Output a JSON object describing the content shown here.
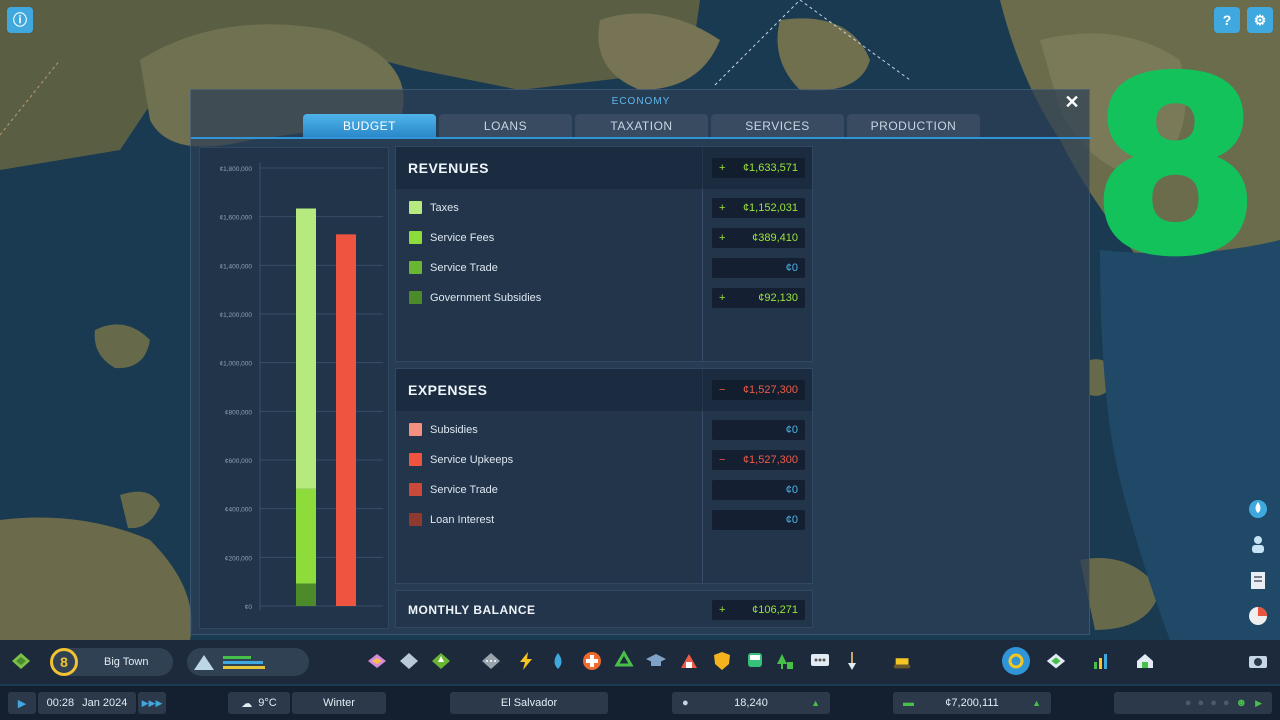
{
  "panel": {
    "title": "ECONOMY",
    "close_glyph": "✕",
    "tabs": [
      {
        "label": "BUDGET",
        "active": true
      },
      {
        "label": "LOANS",
        "active": false
      },
      {
        "label": "TAXATION",
        "active": false
      },
      {
        "label": "SERVICES",
        "active": false
      },
      {
        "label": "PRODUCTION",
        "active": false
      }
    ]
  },
  "overlay_number": "8",
  "revenues": {
    "title": "REVENUES",
    "total": {
      "sign": "+",
      "amount": "¢1,633,571"
    },
    "rows": [
      {
        "label": "Taxes",
        "sign": "+",
        "amount": "¢1,152,031",
        "color": "#b6ea7e"
      },
      {
        "label": "Service Fees",
        "sign": "+",
        "amount": "¢389,410",
        "color": "#8ddc3c"
      },
      {
        "label": "Service Trade",
        "sign": "",
        "amount": "¢0",
        "color": "#6ab534"
      },
      {
        "label": "Government Subsidies",
        "sign": "+",
        "amount": "¢92,130",
        "color": "#4d8a2a"
      }
    ]
  },
  "expenses": {
    "title": "EXPENSES",
    "total": {
      "sign": "−",
      "amount": "¢1,527,300"
    },
    "rows": [
      {
        "label": "Subsidies",
        "sign": "",
        "amount": "¢0",
        "color": "#f49080"
      },
      {
        "label": "Service Upkeeps",
        "sign": "−",
        "amount": "¢1,527,300",
        "color": "#ef5440"
      },
      {
        "label": "Service Trade",
        "sign": "",
        "amount": "¢0",
        "color": "#c94a3a"
      },
      {
        "label": "Loan Interest",
        "sign": "",
        "amount": "¢0",
        "color": "#8f3a2e"
      }
    ]
  },
  "balance": {
    "title": "MONTHLY BALANCE",
    "sign": "+",
    "amount": "¢106,271"
  },
  "chart_data": {
    "type": "bar",
    "yticks": [
      "¢1,800,000",
      "¢1,600,000",
      "¢1,400,000",
      "¢1,200,000",
      "¢1,000,000",
      "¢800,000",
      "¢600,000",
      "¢400,000",
      "¢200,000",
      "¢0"
    ],
    "ylim": [
      0,
      1800000
    ],
    "grid": true,
    "stacks": [
      {
        "name": "Revenues",
        "segments": [
          {
            "name": "Government Subsidies",
            "value": 92130,
            "color": "#4d8a2a"
          },
          {
            "name": "Service Trade",
            "value": 0,
            "color": "#6ab534"
          },
          {
            "name": "Service Fees",
            "value": 389410,
            "color": "#8ddc3c"
          },
          {
            "name": "Taxes",
            "value": 1152031,
            "color": "#b6ea7e"
          }
        ]
      },
      {
        "name": "Expenses",
        "segments": [
          {
            "name": "Service Upkeeps",
            "value": 1527300,
            "color": "#ef5440"
          }
        ]
      }
    ]
  },
  "toolbar": {
    "milestone": "8",
    "city_name": "Big Town"
  },
  "statusbar": {
    "time": "00:28",
    "date": "Jan 2024",
    "temperature": "9°C",
    "season": "Winter",
    "region": "El Salvador",
    "population": "18,240",
    "money": "¢7,200,111"
  }
}
